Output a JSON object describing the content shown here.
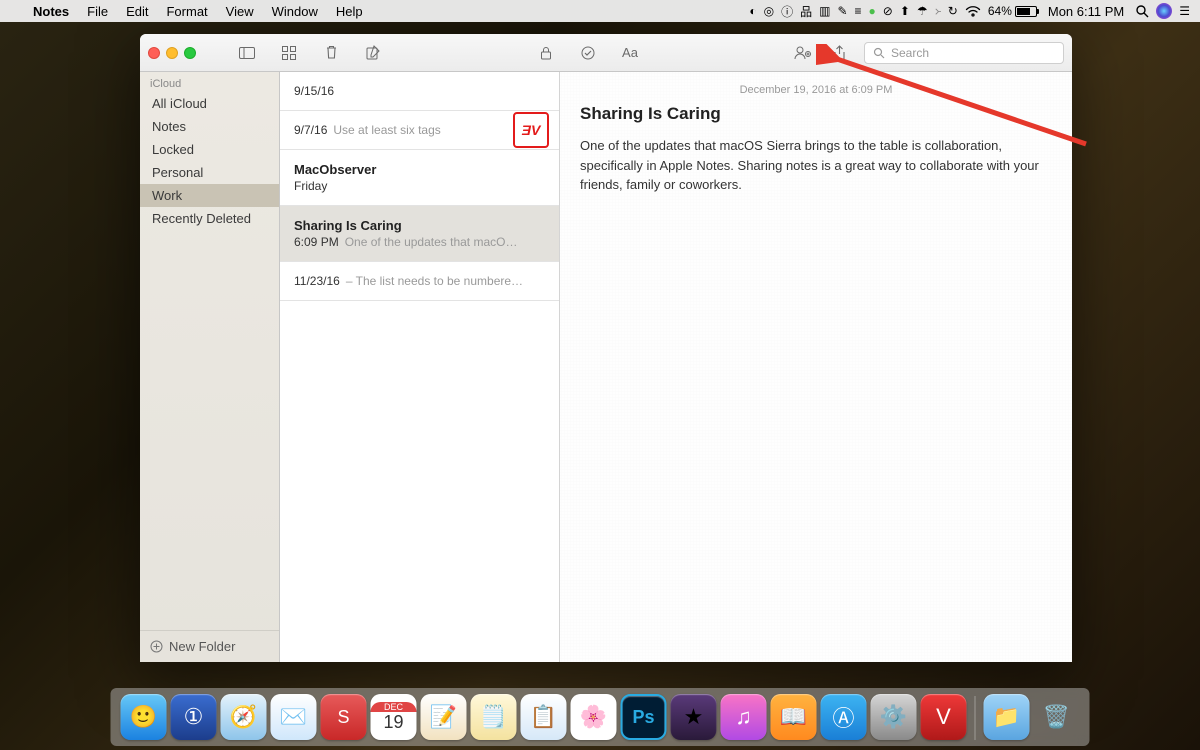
{
  "menubar": {
    "app": "Notes",
    "items": [
      "File",
      "Edit",
      "Format",
      "View",
      "Window",
      "Help"
    ],
    "battery_pct": "64%",
    "clock": "Mon 6:11 PM"
  },
  "toolbar": {
    "search_placeholder": "Search"
  },
  "sidebar": {
    "header": "iCloud",
    "items": [
      "All iCloud",
      "Notes",
      "Locked",
      "Personal",
      "Work",
      "Recently Deleted"
    ],
    "selected_index": 4,
    "new_folder": "New Folder"
  },
  "notelist": {
    "items": [
      {
        "title": "",
        "date": "9/15/16",
        "preview": ""
      },
      {
        "title": "",
        "date": "9/7/16",
        "preview": "Use at least six tags",
        "thumb": "ƎV"
      },
      {
        "title": "MacObserver",
        "date": "Friday",
        "preview": ""
      },
      {
        "title": "Sharing Is Caring",
        "date": "6:09 PM",
        "preview": "One of the updates that macO…",
        "selected": true
      },
      {
        "title": "",
        "date": "11/23/16",
        "preview": "– The list needs to be numbere…"
      }
    ]
  },
  "editor": {
    "date": "December 19, 2016 at 6:09 PM",
    "title": "Sharing Is Caring",
    "body": "One of the updates that macOS Sierra brings to the table is collaboration, specifically in Apple Notes. Sharing notes is a great way to collaborate with your friends, family or coworkers."
  },
  "dock": {
    "items": [
      "finder",
      "1password",
      "safari",
      "mail",
      "fantastical",
      "calendar",
      "reminders",
      "notes",
      "things",
      "photos",
      "photoshop",
      "imovie",
      "itunes",
      "books",
      "appstore",
      "settings",
      "vivaldi"
    ]
  }
}
